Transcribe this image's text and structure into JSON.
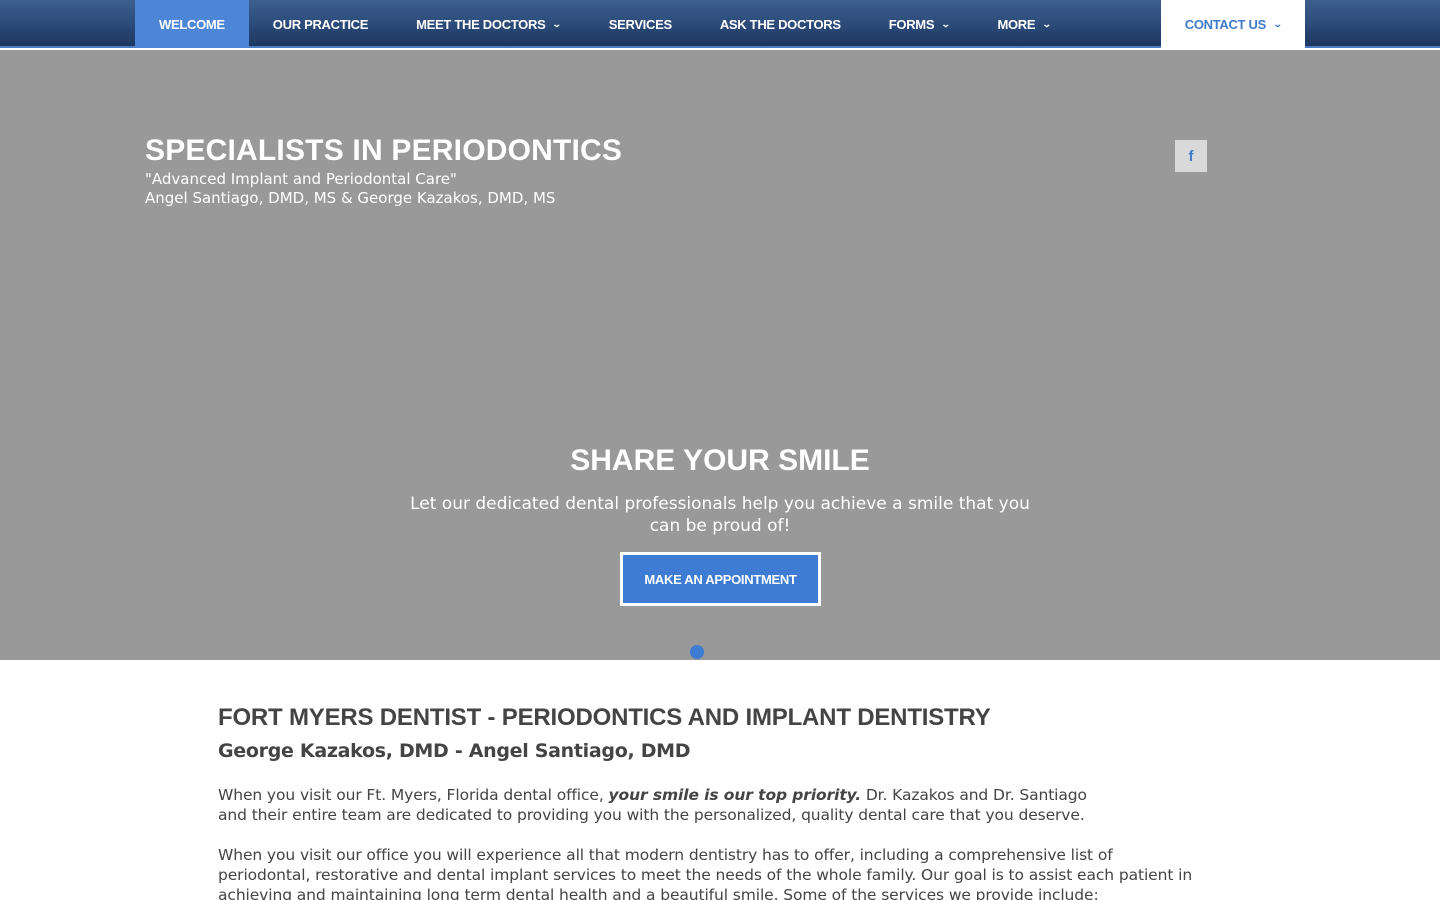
{
  "nav": {
    "items": [
      {
        "label": "WELCOME",
        "dropdown": false,
        "active": true
      },
      {
        "label": "OUR PRACTICE",
        "dropdown": false
      },
      {
        "label": "MEET THE DOCTORS",
        "dropdown": true
      },
      {
        "label": "SERVICES",
        "dropdown": false
      },
      {
        "label": "ASK THE DOCTORS",
        "dropdown": false
      },
      {
        "label": "FORMS",
        "dropdown": true
      },
      {
        "label": "MORE",
        "dropdown": true
      }
    ],
    "contact_label": "CONTACT US",
    "chevron_icon": "chevron-down-icon"
  },
  "hero": {
    "title": "SPECIALISTS IN PERIODONTICS",
    "tagline": "\"Advanced Implant and Periodontal Care\"",
    "doctors": "Angel Santiago, DMD, MS & George Kazakos, DMD, MS",
    "facebook_icon": "facebook-icon",
    "facebook_glyph": "f",
    "slide": {
      "title": "SHARE YOUR SMILE",
      "text": "Let our dedicated dental professionals help you achieve a smile that you can be proud of!",
      "button_label": "MAKE AN APPOINTMENT"
    }
  },
  "content": {
    "heading": "FORT MYERS DENTIST - PERIODONTICS AND IMPLANT DENTISTRY",
    "subheading": "George Kazakos, DMD - Angel Santiago, DMD",
    "p1_before": "When you visit our Ft. Myers, Florida dental office, ",
    "p1_emphasis": "your smile is our top priority.",
    "p1_after": "  Dr. Kazakos and Dr. Santiago and their entire team are dedicated to providing you with the personalized, quality dental care that you deserve.",
    "p2": "When you visit our office you will experience all that modern dentistry has to offer, including a comprehensive list of periodontal, restorative and dental implant  services to meet the  needs of  the whole family. Our goal is to assist each patient in achieving and maintaining long term dental health and a beautiful smile. Some of the services we provide include:"
  },
  "colors": {
    "nav_gradient_top": "#3d5f8e",
    "nav_gradient_bottom": "#1d3760",
    "accent": "#3e7bd3",
    "hero_bg": "#999999"
  }
}
